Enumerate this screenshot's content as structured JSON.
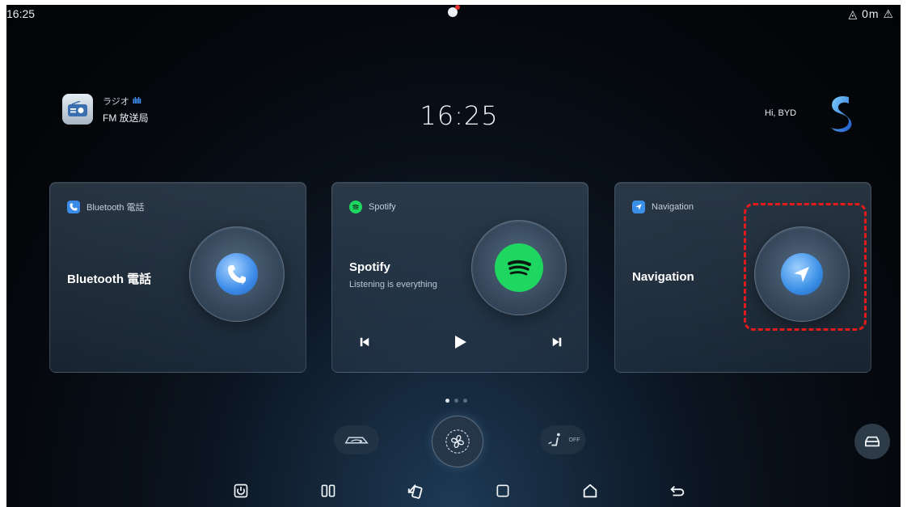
{
  "status_bar": {
    "time": "16:25",
    "right": "◬ 0m ⚠"
  },
  "radio": {
    "title": "ラジオ",
    "station": "FM 放送局"
  },
  "clock": "16:25",
  "greeting": "Hi, BYD",
  "cards": {
    "bluetooth": {
      "header": "Bluetooth 電話",
      "title": "Bluetooth 電話"
    },
    "spotify": {
      "header": "Spotify",
      "title": "Spotify",
      "subtitle": "Listening is everything"
    },
    "navigation": {
      "header": "Navigation",
      "title": "Navigation"
    }
  },
  "page_indicator": {
    "pages": 3,
    "active": 0
  },
  "climate": {
    "seat_label": "OFF"
  },
  "colors": {
    "spotify_green": "#1ed760",
    "bluetooth_blue": "#3c8be8",
    "nav_blue": "#3a8fe6",
    "highlight": "#e11b1b"
  },
  "icons": [
    "radio-icon",
    "equalizer-icon",
    "assistant-icon",
    "phone-icon",
    "spotify-icon",
    "navigation-arrow-icon",
    "previous-track-icon",
    "play-icon",
    "next-track-icon",
    "recirculation-icon",
    "fan-icon",
    "seat-heat-icon",
    "car-icon",
    "power-icon",
    "split-screen-icon",
    "rotate-screen-icon",
    "recent-apps-icon",
    "home-icon",
    "back-icon"
  ]
}
